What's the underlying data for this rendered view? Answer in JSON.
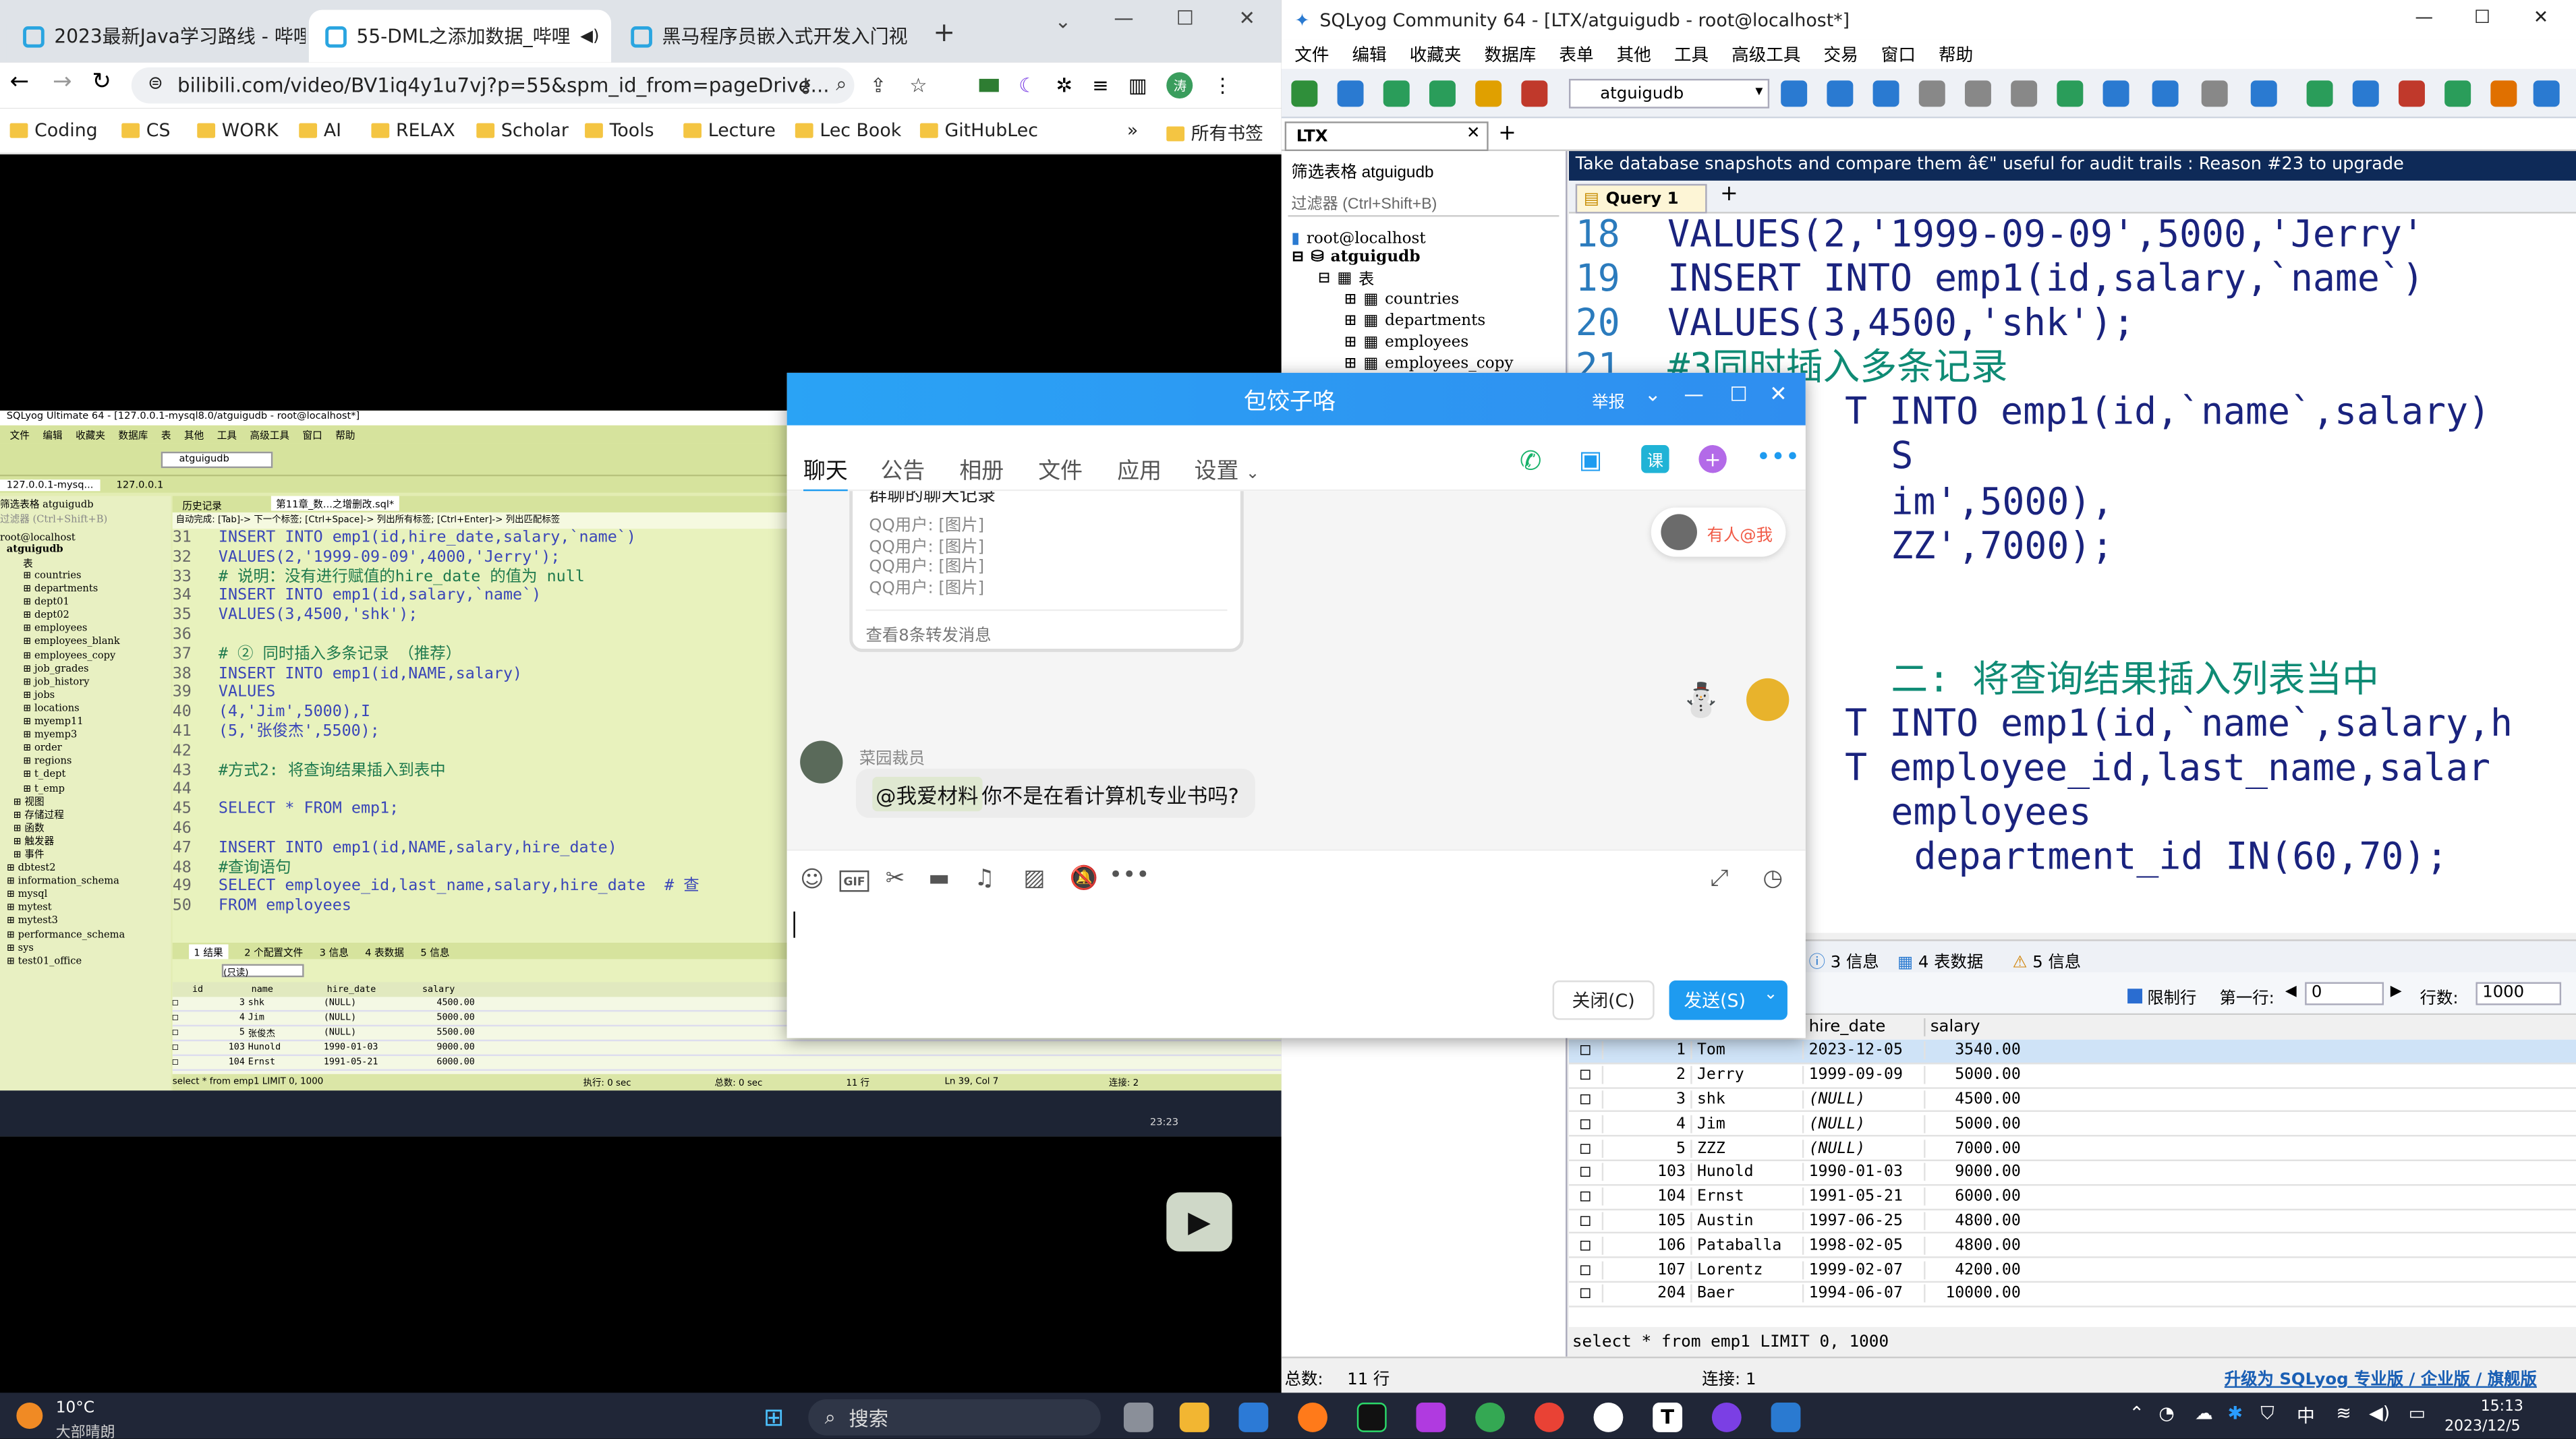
{
  "browser": {
    "tabs": [
      "2023最新Java学习路线 - 哔哩",
      "55-DML之添加数据_哔哩",
      "黑马程序员嵌入式开发入门视"
    ],
    "url": "bilibili.com/video/BV1iq4y1u7vj?p=55&spm_id_from=pageDrive...",
    "bookmarks": [
      "Coding",
      "CS",
      "WORK",
      "AI",
      "RELAX",
      "Scholar",
      "Tools",
      "Lecture",
      "Lec Book",
      "GitHubLec"
    ],
    "more": "»",
    "all_bookmarks": "所有书签",
    "avatar": "涛"
  },
  "video": {
    "title": "SQLyog Ultimate 64 - [127.0.0.1-mysql8.0/atguigudb - root@localhost*]",
    "menu": [
      "文件",
      "编辑",
      "收藏夹",
      "数据库",
      "表",
      "其他",
      "工具",
      "高级工具",
      "窗口",
      "帮助"
    ],
    "db": "atguigudb",
    "conn_tabs": [
      "127.0.0.1-mysq...",
      "127.0.0.1"
    ],
    "query_tabs": [
      "历史记录",
      "第11章_数...之增删改.sql*"
    ],
    "hint": "自动完成: [Tab]-> 下一个标签; [Ctrl+Space]-> 列出所有标签; [Ctrl+Enter]-> 列出匹配标签",
    "filter": "筛选表格  atguigudb",
    "filter_ph": "过滤器 (Ctrl+Shift+B)",
    "tree_root": "root@localhost",
    "tree_db": "atguigudb",
    "tree_tables_label": "表",
    "tree_tables": [
      "countries",
      "departments",
      "dept01",
      "dept02",
      "employees",
      "employees_blank",
      "employees_copy",
      "job_grades",
      "job_history",
      "jobs",
      "locations",
      "myemp11",
      "myemp3",
      "order",
      "regions",
      "t_dept",
      "t_emp"
    ],
    "tree_other": [
      "视图",
      "存储过程",
      "函数",
      "触发器",
      "事件"
    ],
    "tree_dbs": [
      "dbtest2",
      "information_schema",
      "mysql",
      "mytest",
      "mytest3",
      "performance_schema",
      "sys",
      "test01_office"
    ],
    "code": [
      {
        "n": "31",
        "t": "INSERT INTO emp1(id,hire_date,salary,`name`)"
      },
      {
        "n": "32",
        "t": "VALUES(2,'1999-09-09',4000,'Jerry');"
      },
      {
        "n": "33",
        "t": "# 说明：没有进行赋值的hire_date 的值为 null"
      },
      {
        "n": "34",
        "t": "INSERT INTO emp1(id,salary,`name`)"
      },
      {
        "n": "35",
        "t": "VALUES(3,4500,'shk');"
      },
      {
        "n": "36",
        "t": ""
      },
      {
        "n": "37",
        "t": "# ② 同时插入多条记录 （推荐）"
      },
      {
        "n": "38",
        "t": "INSERT INTO emp1(id,NAME,salary)"
      },
      {
        "n": "39",
        "t": "VALUES"
      },
      {
        "n": "40",
        "t": "(4,'Jim',5000),I"
      },
      {
        "n": "41",
        "t": "(5,'张俊杰',5500);"
      },
      {
        "n": "42",
        "t": ""
      },
      {
        "n": "43",
        "t": "#方式2: 将查询结果插入到表中"
      },
      {
        "n": "44",
        "t": ""
      },
      {
        "n": "45",
        "t": "SELECT * FROM emp1;"
      },
      {
        "n": "46",
        "t": ""
      },
      {
        "n": "47",
        "t": "INSERT INTO emp1(id,NAME,salary,hire_date)"
      },
      {
        "n": "48",
        "t": "#查询语句"
      },
      {
        "n": "49",
        "t": "SELECT employee_id,last_name,salary,hire_date  # 查"
      },
      {
        "n": "50",
        "t": "FROM employees"
      }
    ],
    "result_tabs": [
      "1 结果",
      "2 个配置文件",
      "3 信息",
      "4 表数据",
      "5 信息"
    ],
    "readonly": "(只读)",
    "grid_headers": [
      "id",
      "name",
      "hire_date",
      "salary"
    ],
    "grid_rows": [
      [
        "3",
        "shk",
        "(NULL)",
        "4500.00"
      ],
      [
        "4",
        "Jim",
        "(NULL)",
        "5000.00"
      ],
      [
        "5",
        "张俊杰",
        "(NULL)",
        "5500.00"
      ],
      [
        "103",
        "Hunold",
        "1990-01-03",
        "9000.00"
      ],
      [
        "104",
        "Ernst",
        "1991-05-21",
        "6000.00"
      ]
    ],
    "status": [
      "select * from emp1 LIMIT 0, 1000",
      "执行: 0 sec",
      "总数: 0 sec",
      "11 行",
      "Ln 39, Col 7",
      "连接: 2"
    ],
    "clock": "23:23"
  },
  "sqlyog": {
    "title": "SQLyog Community 64 - [LTX/atguigudb - root@localhost*]",
    "menu": [
      "文件",
      "编辑",
      "收藏夹",
      "数据库",
      "表单",
      "其他",
      "工具",
      "高级工具",
      "交易",
      "窗口",
      "帮助"
    ],
    "db": "atguigudb",
    "conn_tab": "LTX",
    "add": "+",
    "filter": "筛选表格  atguigudb",
    "filter_ph": "过滤器 (Ctrl+Shift+B)",
    "tree_root": "root@localhost",
    "tree_db": "atguigudb",
    "tree_tables_label": "表",
    "tree_tables": [
      "countries",
      "departments",
      "employees",
      "employees_copy"
    ],
    "banner": "Take database snapshots and compare them â€\" useful for audit trails : Reason #23 to upgrade",
    "query_tab": "Query 1",
    "code": [
      {
        "n": "18",
        "t": "VALUES(2,'1999-09-09',5000,'Jerry'"
      },
      {
        "n": "19",
        "t": "INSERT INTO emp1(id,salary,`name`)"
      },
      {
        "n": "20",
        "t": "VALUES(3,4500,'shk');"
      },
      {
        "n": "21",
        "t": "#3同时插入多条记录"
      },
      {
        "n": "",
        "t": "T INTO emp1(id,`name`,salary)"
      },
      {
        "n": "",
        "t": "S"
      },
      {
        "n": "",
        "t": "im',5000),"
      },
      {
        "n": "",
        "t": "ZZ',7000);"
      },
      {
        "n": "",
        "t": ""
      },
      {
        "n": "",
        "t": ""
      },
      {
        "n": "",
        "t": "二: 将查询结果插入列表当中"
      },
      {
        "n": "",
        "t": "T INTO emp1(id,`name`,salary,h"
      },
      {
        "n": "",
        "t": "T employee_id,last_name,salar"
      },
      {
        "n": "",
        "t": "employees"
      },
      {
        "n": "",
        "t": "department_id IN(60,70);"
      }
    ],
    "result_tabs": [
      "3 信息",
      "4 表数据",
      "5 信息"
    ],
    "limit_label": "限制行",
    "first_row": "第一行:",
    "first_val": "0",
    "rows_label": "行数:",
    "rows_val": "1000",
    "grid_headers": [
      "hire_date",
      "salary"
    ],
    "grid_rows": [
      [
        "1",
        "Tom",
        "2023-12-05",
        "3540.00"
      ],
      [
        "2",
        "Jerry",
        "1999-09-09",
        "5000.00"
      ],
      [
        "3",
        "shk",
        "(NULL)",
        "4500.00"
      ],
      [
        "4",
        "Jim",
        "(NULL)",
        "5000.00"
      ],
      [
        "5",
        "ZZZ",
        "(NULL)",
        "7000.00"
      ],
      [
        "103",
        "Hunold",
        "1990-01-03",
        "9000.00"
      ],
      [
        "104",
        "Ernst",
        "1991-05-21",
        "6000.00"
      ],
      [
        "105",
        "Austin",
        "1997-06-25",
        "4800.00"
      ],
      [
        "106",
        "Pataballa",
        "1998-02-05",
        "4800.00"
      ],
      [
        "107",
        "Lorentz",
        "1999-02-07",
        "4200.00"
      ],
      [
        "204",
        "Baer",
        "1994-06-07",
        "10000.00"
      ]
    ],
    "status_sql": "select * from emp1 LIMIT 0, 1000",
    "status_total": "总数:",
    "status_rows": "11 行",
    "status_conn": "连接: 1",
    "upgrade": "升级为 SQLyog 专业版 / 企业版 / 旗舰版"
  },
  "qq": {
    "title": "包饺子咯",
    "report": "举报",
    "tabs": [
      "聊天",
      "公告",
      "相册",
      "文件",
      "应用",
      "设置"
    ],
    "forward_title": "群聊的聊天记录",
    "forward_lines": [
      "QQ用户: [图片]",
      "QQ用户: [图片]",
      "QQ用户: [图片]",
      "QQ用户: [图片]"
    ],
    "forward_footer": "查看8条转发消息",
    "mention": "有人@我",
    "sender": "菜园裁员",
    "at": "@我爱材料",
    "message": " 你不是在看计算机专业书吗?",
    "close": "关闭(C)",
    "send": "发送(S)"
  },
  "taskbar": {
    "weather": "10°C",
    "weather_desc": "大部晴朗",
    "search": "搜索",
    "time": "15:13",
    "date": "2023/12/5",
    "ime": "中"
  }
}
